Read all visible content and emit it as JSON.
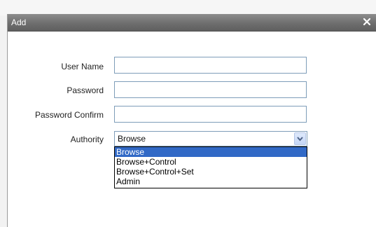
{
  "dialog": {
    "title": "Add",
    "close_icon": "close-icon"
  },
  "form": {
    "user_name_label": "User Name",
    "user_name_value": "",
    "password_label": "Password",
    "password_value": "",
    "password_confirm_label": "Password Confirm",
    "password_confirm_value": "",
    "authority_label": "Authority",
    "authority_selected": "Browse",
    "authority_options": [
      "Browse",
      "Browse+Control",
      "Browse+Control+Set",
      "Admin"
    ],
    "authority_highlighted_index": 0
  },
  "colors": {
    "titlebar": "#6e6e6e",
    "input_border": "#7e9db9",
    "selection": "#3169c6"
  }
}
